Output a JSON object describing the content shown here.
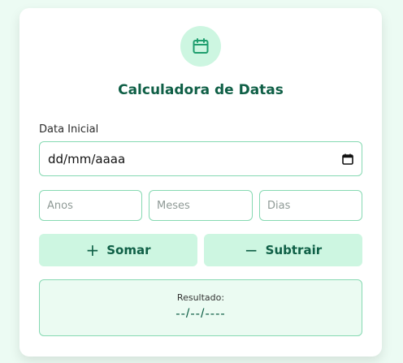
{
  "app": {
    "title": "Calculadora de Datas"
  },
  "start_date": {
    "label": "Data Inicial",
    "value": "dd/mm/aaaa"
  },
  "fields": {
    "years_placeholder": "Anos",
    "months_placeholder": "Meses",
    "days_placeholder": "Dias"
  },
  "actions": {
    "add_symbol": "+",
    "add_label": "Somar",
    "subtract_symbol": "−",
    "subtract_label": "Subtrair"
  },
  "result": {
    "label": "Resultado:",
    "value": "--/--/----"
  },
  "icons": {
    "header": "calendar-icon",
    "date_picker": "calendar-picker-icon"
  },
  "colors": {
    "accent": "#0f5f46",
    "accent_light": "#cdf6e1",
    "border": "#86d9b2",
    "background": "#ecfbf3"
  }
}
